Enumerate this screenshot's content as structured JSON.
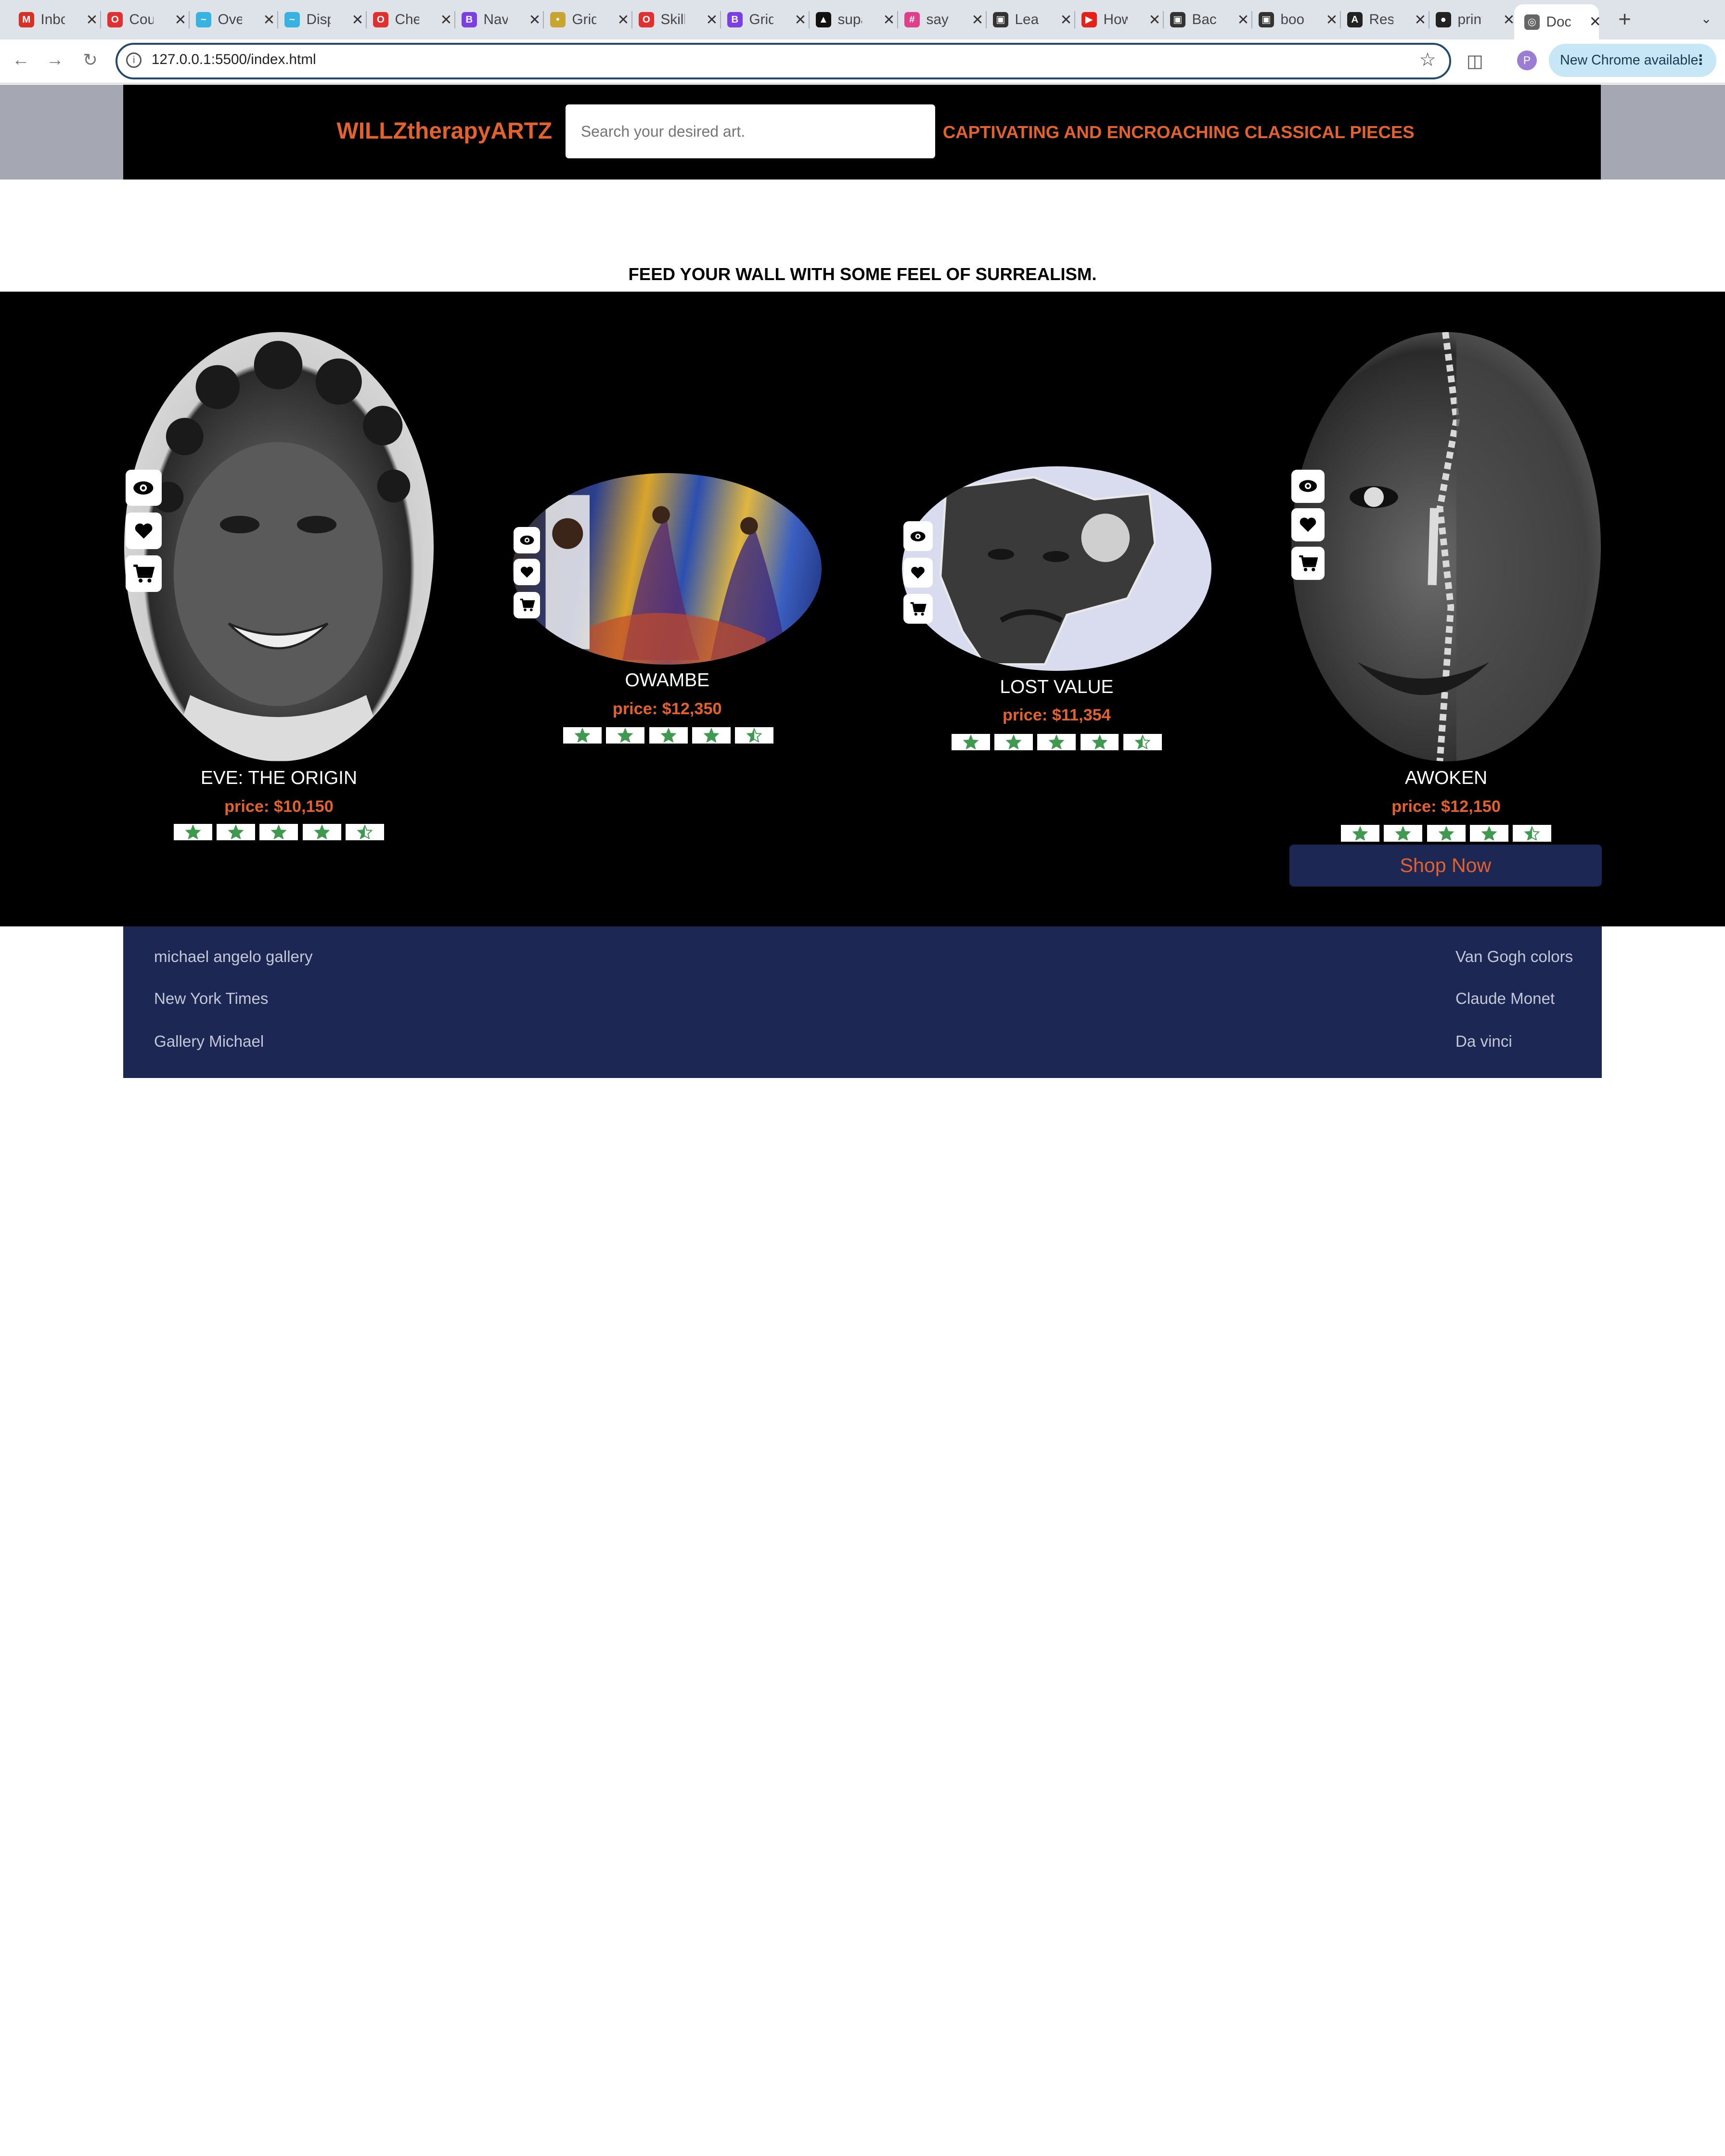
{
  "browser": {
    "tabs": [
      {
        "label": "Inbox",
        "color": "#d93025",
        "glyph": "M"
      },
      {
        "label": "Course",
        "color": "#e03030",
        "glyph": "O"
      },
      {
        "label": "Overview",
        "color": "#38b2e0",
        "glyph": "~"
      },
      {
        "label": "Display",
        "color": "#38b2e0",
        "glyph": "~"
      },
      {
        "label": "Check",
        "color": "#e03030",
        "glyph": "O"
      },
      {
        "label": "Navbar",
        "color": "#7b3fe4",
        "glyph": "B"
      },
      {
        "label": "Grid",
        "color": "#c8a530",
        "glyph": "•"
      },
      {
        "label": "Skills",
        "color": "#e03030",
        "glyph": "O"
      },
      {
        "label": "Grid",
        "color": "#7b3fe4",
        "glyph": "B"
      },
      {
        "label": "supabase",
        "color": "#111111",
        "glyph": "▲"
      },
      {
        "label": "say",
        "color": "#e0408a",
        "glyph": "#"
      },
      {
        "label": "Learn",
        "color": "#333333",
        "glyph": "▣"
      },
      {
        "label": "How",
        "color": "#e62117",
        "glyph": "▶"
      },
      {
        "label": "Backend",
        "color": "#333333",
        "glyph": "▣"
      },
      {
        "label": "book",
        "color": "#333333",
        "glyph": "▣"
      },
      {
        "label": "Resume",
        "color": "#222222",
        "glyph": "A"
      },
      {
        "label": "print",
        "color": "#222222",
        "glyph": "●"
      },
      {
        "label": "Document",
        "color": "#666666",
        "glyph": "◎",
        "active": true
      }
    ],
    "url": "127.0.0.1:5500/index.html",
    "update_label": "New Chrome available",
    "profile_initial": "P"
  },
  "header": {
    "brand": "WILLZtherapyARTZ",
    "search_placeholder": "Search your desired art.",
    "tagline": "CAPTIVATING AND ENCROACHING CLASSICAL PIECES"
  },
  "headline": "FEED YOUR WALL WITH SOME FEEL OF SURREALISM.",
  "products": [
    {
      "title": "EVE: THE ORIGIN",
      "price": "price: $10,150",
      "rating": 4.5
    },
    {
      "title": "OWAMBE",
      "price": "price: $12,350",
      "rating": 4.5
    },
    {
      "title": "LOST VALUE",
      "price": "price: $11,354",
      "rating": 4.5
    },
    {
      "title": "AWOKEN",
      "price": "price: $12,150",
      "rating": 4.5
    }
  ],
  "shop_now_label": "Shop Now",
  "footer": {
    "left_links": [
      "michael angelo gallery",
      "New York Times",
      "Gallery Michael"
    ],
    "right_links": [
      "Van Gogh colors",
      "Claude Monet",
      "Da vinci"
    ]
  },
  "colors": {
    "accent": "#e2612d",
    "navy": "#1c2754",
    "star_green": "#3f9a4f"
  }
}
